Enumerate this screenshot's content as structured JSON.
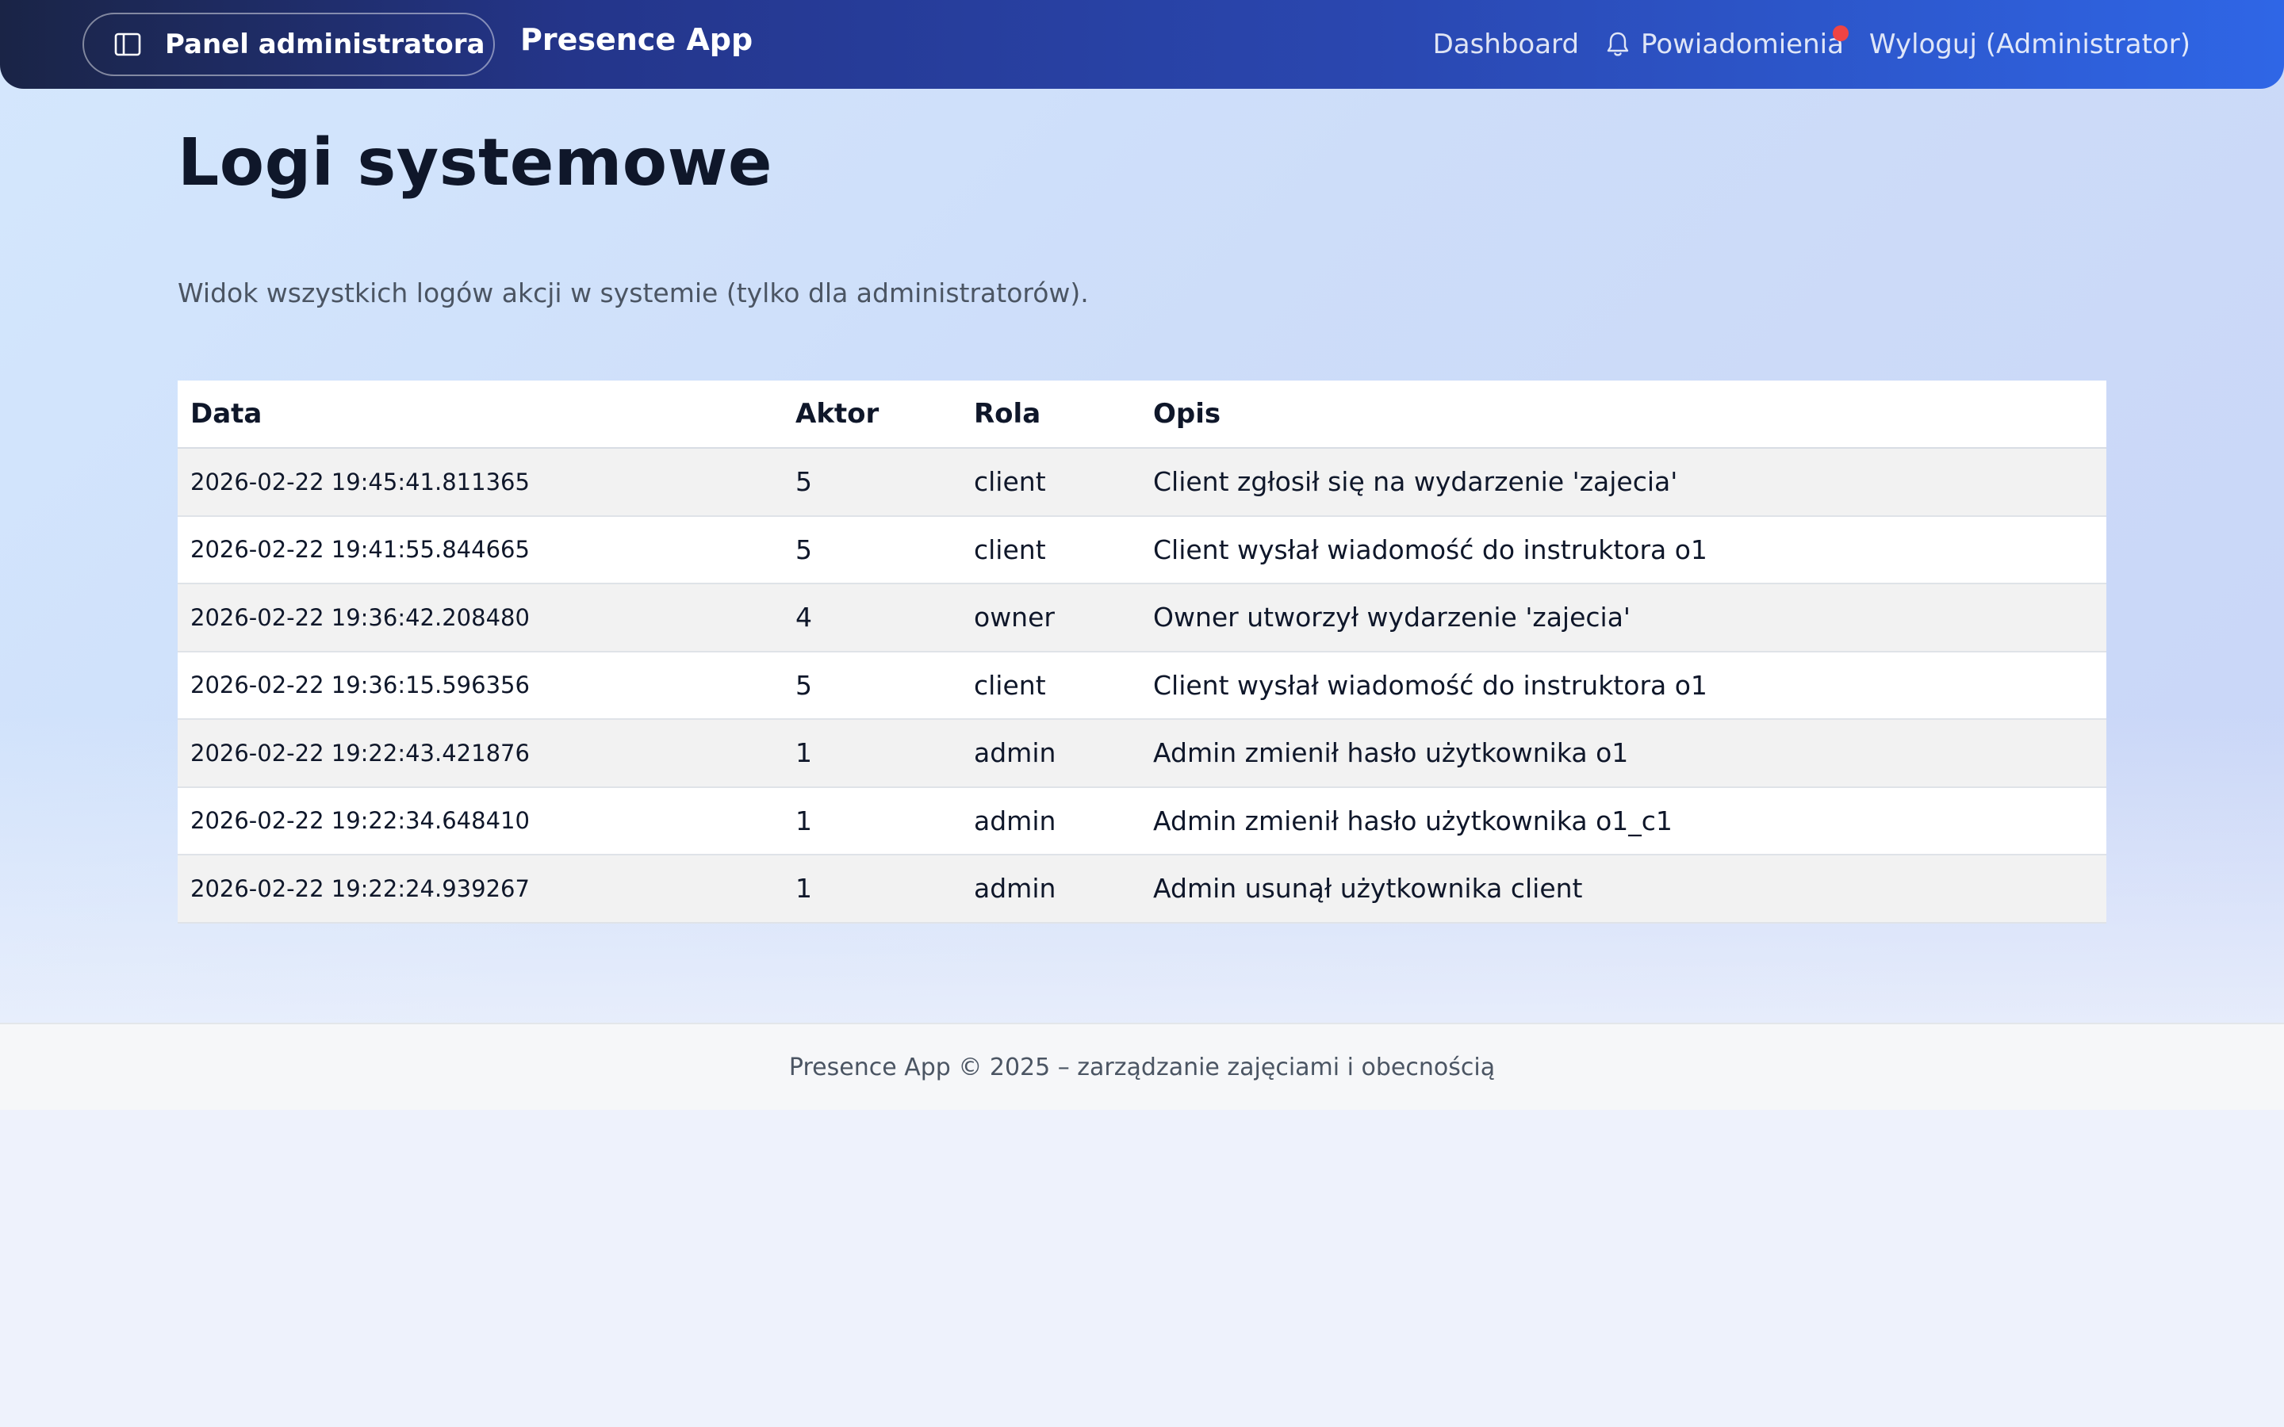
{
  "navbar": {
    "admin_panel_label": "Panel administratora",
    "brand": "Presence App",
    "dashboard_label": "Dashboard",
    "notifications_label": "Powiadomienia",
    "logout_label": "Wyloguj (Administrator)",
    "colors": {
      "gradient_start": "#1a2446",
      "gradient_end": "#2f66e6",
      "notification_dot": "#ef4444"
    }
  },
  "main": {
    "title": "Logi systemowe",
    "description": "Widok wszystkich logów akcji w systemie (tylko dla administratorów)."
  },
  "table": {
    "headers": [
      "Data",
      "Aktor",
      "Rola",
      "Opis"
    ],
    "rows": [
      {
        "date": "2026-02-22 19:45:41.811365",
        "actor": "5",
        "role": "client",
        "desc": "Client zgłosił się na wydarzenie 'zajecia'"
      },
      {
        "date": "2026-02-22 19:41:55.844665",
        "actor": "5",
        "role": "client",
        "desc": "Client wysłał wiadomość do instruktora o1"
      },
      {
        "date": "2026-02-22 19:36:42.208480",
        "actor": "4",
        "role": "owner",
        "desc": "Owner utworzył wydarzenie 'zajecia'"
      },
      {
        "date": "2026-02-22 19:36:15.596356",
        "actor": "5",
        "role": "client",
        "desc": "Client wysłał wiadomość do instruktora o1"
      },
      {
        "date": "2026-02-22 19:22:43.421876",
        "actor": "1",
        "role": "admin",
        "desc": "Admin zmienił hasło użytkownika o1"
      },
      {
        "date": "2026-02-22 19:22:34.648410",
        "actor": "1",
        "role": "admin",
        "desc": "Admin zmienił hasło użytkownika o1_c1"
      },
      {
        "date": "2026-02-22 19:22:24.939267",
        "actor": "1",
        "role": "admin",
        "desc": "Admin usunął użytkownika client"
      }
    ]
  },
  "footer": {
    "text": "Presence App © 2025 – zarządzanie zajęciami i obecnością"
  },
  "icons": {
    "admin_panel": "sidebar-toggle-icon",
    "notifications": "bell-icon"
  }
}
